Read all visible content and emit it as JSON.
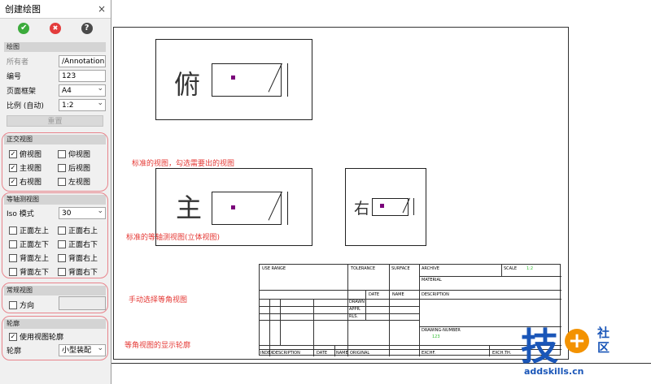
{
  "panel": {
    "title": "创建绘图",
    "close_glyph": "×",
    "ok_glyph": "✔",
    "cancel_glyph": "✖",
    "help_glyph": "?",
    "drawing_section": "绘图",
    "owner_label": "所有者",
    "owner_value": "/Annotation",
    "number_label": "编号",
    "number_value": "123",
    "frame_label": "页面框架",
    "frame_value": "A4",
    "scale_label": "比例 (自动)",
    "scale_value": "1:2",
    "reset_label": "重置",
    "ortho_section": "正交视图",
    "ortho": [
      "俯视图",
      "仰视图",
      "主视图",
      "后视图",
      "右视图",
      "左视图"
    ],
    "iso_section": "等轴测视图",
    "iso_mode_label": "Iso 模式",
    "iso_mode_value": "30",
    "iso": [
      "正面左上",
      "正面右上",
      "正面左下",
      "正面右下",
      "背面左上",
      "背面右上",
      "背面左下",
      "背面右下"
    ],
    "custom_section": "常规视图",
    "direction_label": "方向",
    "outline_section": "轮廓",
    "use_outline_label": "使用视图轮廓",
    "outline_label": "轮廓",
    "outline_value": "小型装配"
  },
  "views": {
    "top_label": "俯",
    "front_label": "主",
    "right_label": "右"
  },
  "notes": {
    "n1": "标准的视图，勾选需要出的视图",
    "n2": "标准的等轴测视图(立体视图)",
    "n3": "手动选择等角视图",
    "n4": "等角视图的显示轮廓"
  },
  "titleblock": {
    "use_range": "USE RANGE",
    "tolerance": "TOLERANCE",
    "surface": "SURFACE",
    "archive": "ARCHIVE",
    "scale": "SCALE",
    "scale_value": "1:2",
    "material": "MATERIAL",
    "date": "DATE",
    "name": "NAME",
    "description": "DESCRIPTION",
    "drawn": "DRAWN",
    "appr": "APPR.",
    "rls": "RLS.",
    "drawing_number": "DRAWING-NUMBER",
    "drawing_number_value": "123",
    "index": "INDEX",
    "description2": "DESCRIPTION",
    "date2": "DATE",
    "name2": "NAME",
    "original": "ORIGINAL",
    "exchf": "EXCHF.",
    "exch_th": "EXCH.TH."
  },
  "logo": {
    "main": "技",
    "community1": "社",
    "community2": "区",
    "url": "addskills.cn"
  },
  "colors": {
    "accent_red": "#e53935",
    "ok_green": "#3cab3c",
    "cancel_red": "#e33c3c",
    "help_gray": "#4a4a4a",
    "logo_blue": "#1a56b8",
    "logo_orange": "#f39200",
    "view_marker": "#7a007a",
    "scale_green": "#2ebd2e"
  }
}
